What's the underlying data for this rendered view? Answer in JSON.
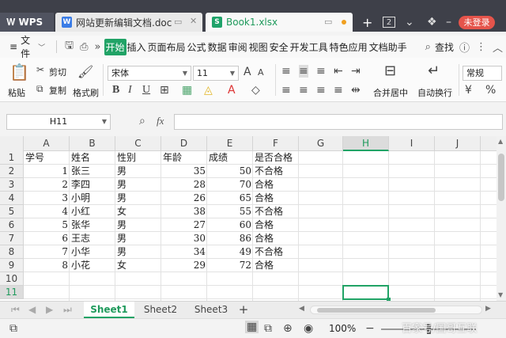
{
  "titlebar": {
    "wps_label": "WPS",
    "doc_tab": "网站更新编辑文档.doc",
    "xls_tab": "Book1.xlsx",
    "page_badge": "2",
    "login": "未登录"
  },
  "menu": {
    "file": "文件",
    "tabs": [
      "开始",
      "插入",
      "页面布局",
      "公式",
      "数据",
      "审阅",
      "视图",
      "安全",
      "开发工具",
      "特色应用",
      "文档助手"
    ],
    "active_tab": "开始",
    "search": "查找"
  },
  "ribbon": {
    "paste": "粘贴",
    "cut": "剪切",
    "copy": "复制",
    "format_painter": "格式刷",
    "font": "宋体",
    "size": "11",
    "merge": "合并居中",
    "wrap": "自动换行",
    "number_format": "常规"
  },
  "formula": {
    "cell_ref": "H11",
    "fx": "fx",
    "content": ""
  },
  "sheet": {
    "columns": [
      "A",
      "B",
      "C",
      "D",
      "E",
      "F",
      "G",
      "H",
      "I",
      "J"
    ],
    "selected_column": "H",
    "row_numbers": [
      "1",
      "2",
      "3",
      "4",
      "5",
      "6",
      "7",
      "8",
      "9",
      "10",
      "11"
    ],
    "selected_row": "11",
    "header": [
      "学号",
      "姓名",
      "性别",
      "年龄",
      "成绩",
      "是否合格"
    ],
    "rows": [
      [
        "1",
        "张三",
        "男",
        "35",
        "50",
        "不合格"
      ],
      [
        "2",
        "李四",
        "男",
        "28",
        "70",
        "合格"
      ],
      [
        "3",
        "小明",
        "男",
        "26",
        "65",
        "合格"
      ],
      [
        "4",
        "小红",
        "女",
        "38",
        "55",
        "不合格"
      ],
      [
        "5",
        "张华",
        "男",
        "27",
        "60",
        "合格"
      ],
      [
        "6",
        "王志",
        "男",
        "30",
        "86",
        "合格"
      ],
      [
        "7",
        "小华",
        "男",
        "34",
        "49",
        "不合格"
      ],
      [
        "8",
        "小花",
        "女",
        "29",
        "72",
        "合格"
      ]
    ]
  },
  "tabs": {
    "sheets": [
      "Sheet1",
      "Sheet2",
      "Sheet3"
    ],
    "active": "Sheet1",
    "add": "+"
  },
  "status": {
    "zoom": "100%",
    "watermark": "百家号/国哥互联"
  }
}
